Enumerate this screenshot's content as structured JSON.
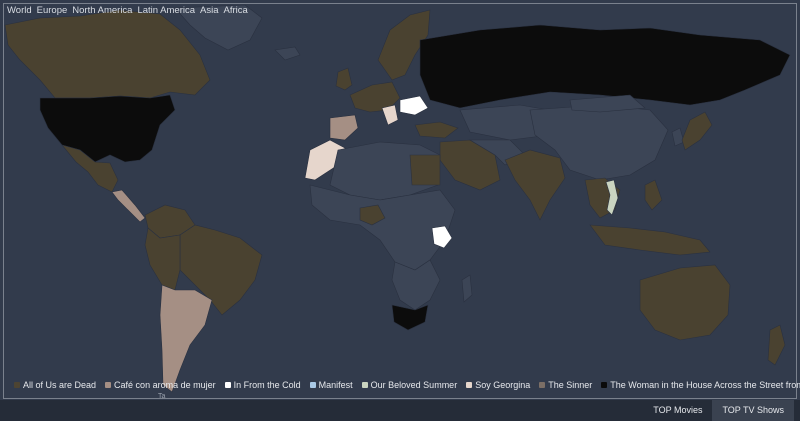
{
  "regions": [
    "World",
    "Europe",
    "North America",
    "Latin America",
    "Asia",
    "Africa"
  ],
  "legend": [
    {
      "label": "All of Us are Dead",
      "color": "#4d4432"
    },
    {
      "label": "Café con aroma de mujer",
      "color": "#a58f84"
    },
    {
      "label": "In From the Cold",
      "color": "#ffffff"
    },
    {
      "label": "Manifest",
      "color": "#a9c9e6"
    },
    {
      "label": "Our Beloved Summer",
      "color": "#cad4c0"
    },
    {
      "label": "Soy Georgina",
      "color": "#e6d6cc"
    },
    {
      "label": "The Sinner",
      "color": "#7c6f66"
    },
    {
      "label": "The Woman in the House Across the Street from the Girl in the Window",
      "color": "#0b0b0b"
    }
  ],
  "tabs": [
    {
      "label": "TOP Movies",
      "active": false
    },
    {
      "label": "TOP TV Shows",
      "active": true
    }
  ],
  "credit": "Ta"
}
